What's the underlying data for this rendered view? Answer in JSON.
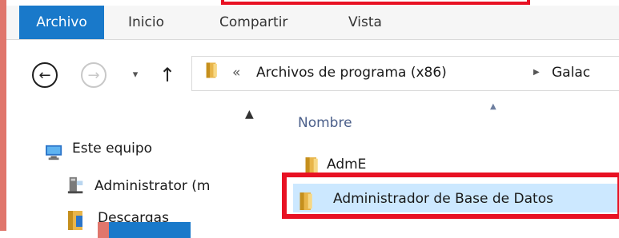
{
  "ribbon": {
    "tabs": [
      "Archivo",
      "Inicio",
      "Compartir",
      "Vista"
    ]
  },
  "nav": {
    "back_icon": "back-arrow-icon",
    "forward_icon": "forward-arrow-icon",
    "up_icon": "up-arrow-icon",
    "address": {
      "chevrons": "«",
      "crumb1": "Archivos de programa (x86)",
      "crumb2": "Galac"
    }
  },
  "nav_pane": {
    "items": [
      {
        "label": "Este equipo"
      },
      {
        "label": "Administrator (m"
      },
      {
        "label": "Descargas"
      }
    ]
  },
  "content": {
    "column_header": "Nombre",
    "rows": [
      {
        "label": "AdmE"
      },
      {
        "label": "Administrador de Base de Datos"
      }
    ]
  },
  "colors": {
    "accent": "#1979ca",
    "selection": "#cce8ff",
    "highlight_box": "#e81123"
  }
}
